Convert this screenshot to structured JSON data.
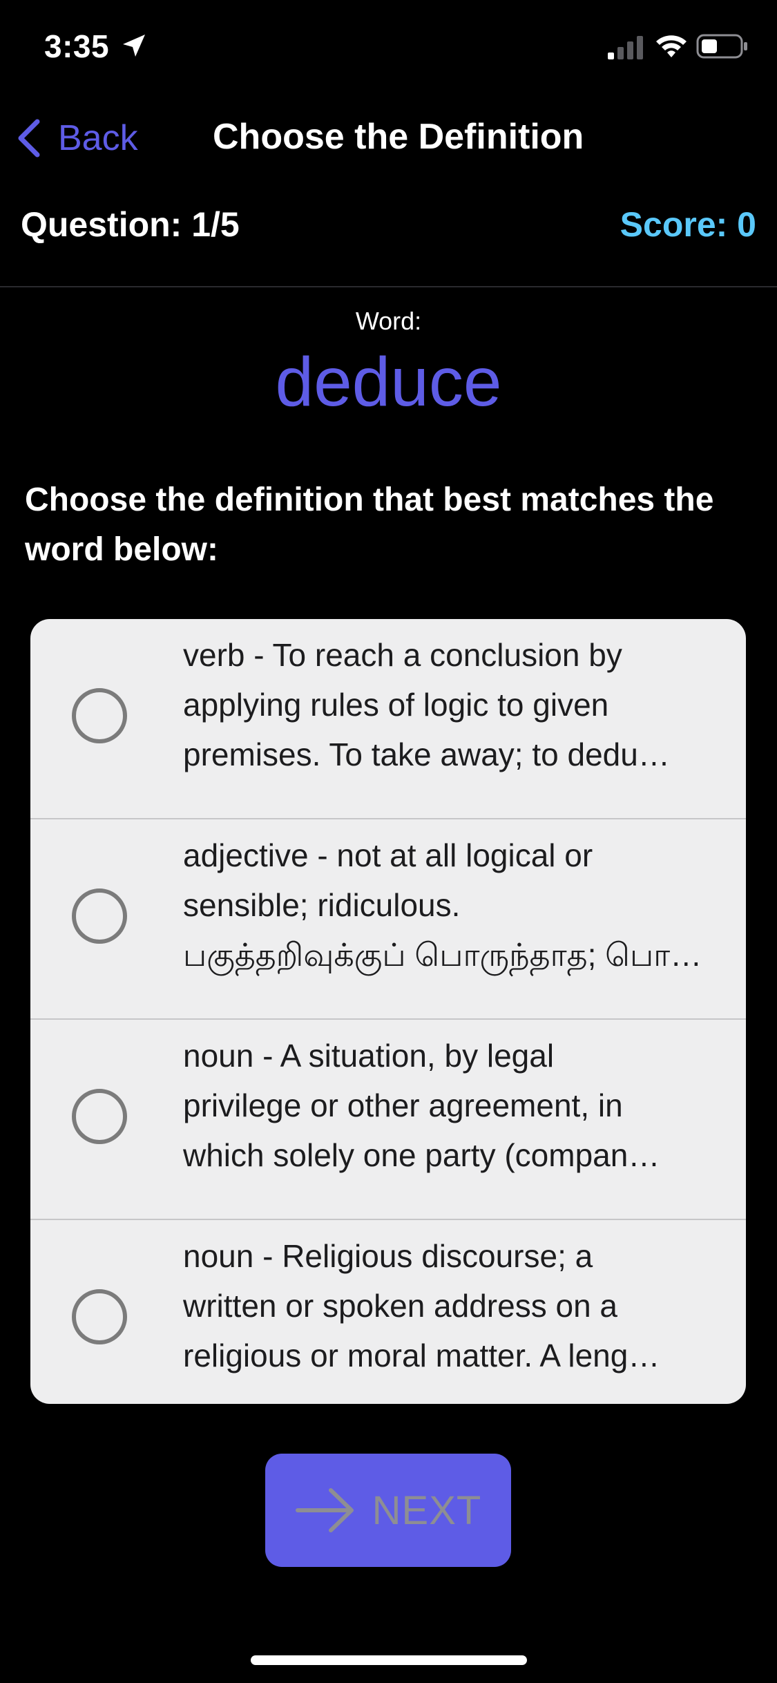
{
  "status_bar": {
    "time": "3:35",
    "location_icon": "location-arrow-icon",
    "signal_icon": "cellular-signal-icon",
    "wifi_icon": "wifi-icon",
    "battery_icon": "battery-icon"
  },
  "nav": {
    "back_label": "Back",
    "title": "Choose the Definition"
  },
  "quiz": {
    "question": "Question: 1/5",
    "score": "Score: 0"
  },
  "word": {
    "caption": "Word:",
    "value": "deduce"
  },
  "instruction": "Choose the definition that best matches the word below:",
  "options": [
    {
      "lines": [
        "verb -  To reach a conclusion by",
        "applying rules of logic to given",
        "premises. To take away; to dedu…"
      ]
    },
    {
      "lines": [
        "adjective - not at all logical or",
        "sensible; ridiculous.",
        "பகுத்தறிவுக்குப் பொருந்தாத; பொ…"
      ]
    },
    {
      "lines": [
        "noun -  A situation, by legal",
        "privilege or other agreement, in",
        "which solely one party (compan…"
      ]
    },
    {
      "lines": [
        "noun -  Religious discourse; a",
        "written or spoken address on a",
        "religious or moral matter. A leng…"
      ]
    }
  ],
  "next_button": {
    "label": "NEXT",
    "icon": "arrow-right-icon"
  },
  "colors": {
    "accent": "#5e5ce6",
    "score": "#5ac8fa",
    "card_background": "#eeeeef",
    "background": "#000000"
  }
}
